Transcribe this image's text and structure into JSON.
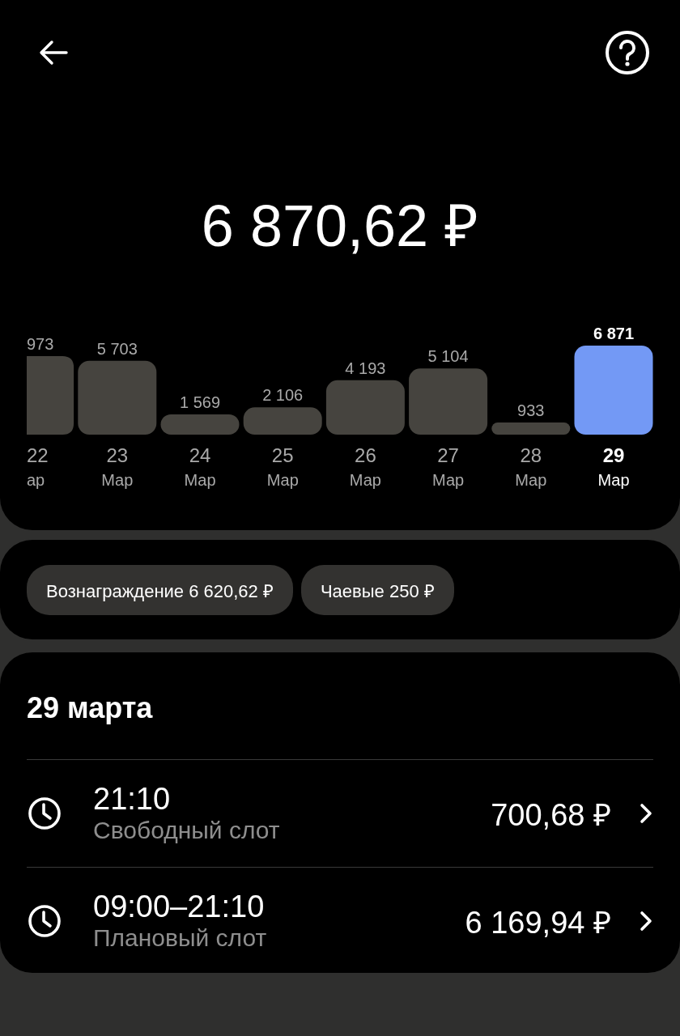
{
  "header": {
    "total": "6 870,62 ₽"
  },
  "chart": {
    "cut_off_column": {
      "value": "973",
      "day": "22",
      "month": "ар"
    },
    "chart_data": {
      "type": "bar",
      "data_labels": true,
      "categories": [
        "23\nМар",
        "24\nМар",
        "25\nМар",
        "26\nМар",
        "27\nМар",
        "28\nМар",
        "29\nМар"
      ],
      "series": [
        {
          "color": "#46443f",
          "values": [
            5703,
            1569,
            2106,
            4193,
            5104,
            933,
            null
          ]
        },
        {
          "color": "#7399f5",
          "values": [
            null,
            null,
            null,
            null,
            null,
            null,
            6871
          ]
        }
      ]
    }
  },
  "chips": [
    "Вознаграждение 6 620,62 ₽",
    "Чаевые 250 ₽"
  ],
  "day": {
    "title": "29 марта",
    "slots": [
      {
        "time": "21:10",
        "type": "Свободный слот",
        "amount": "700,68 ₽"
      },
      {
        "time": "09:00–21:10",
        "type": "Плановый слот",
        "amount": "6 169,94 ₽"
      }
    ]
  }
}
